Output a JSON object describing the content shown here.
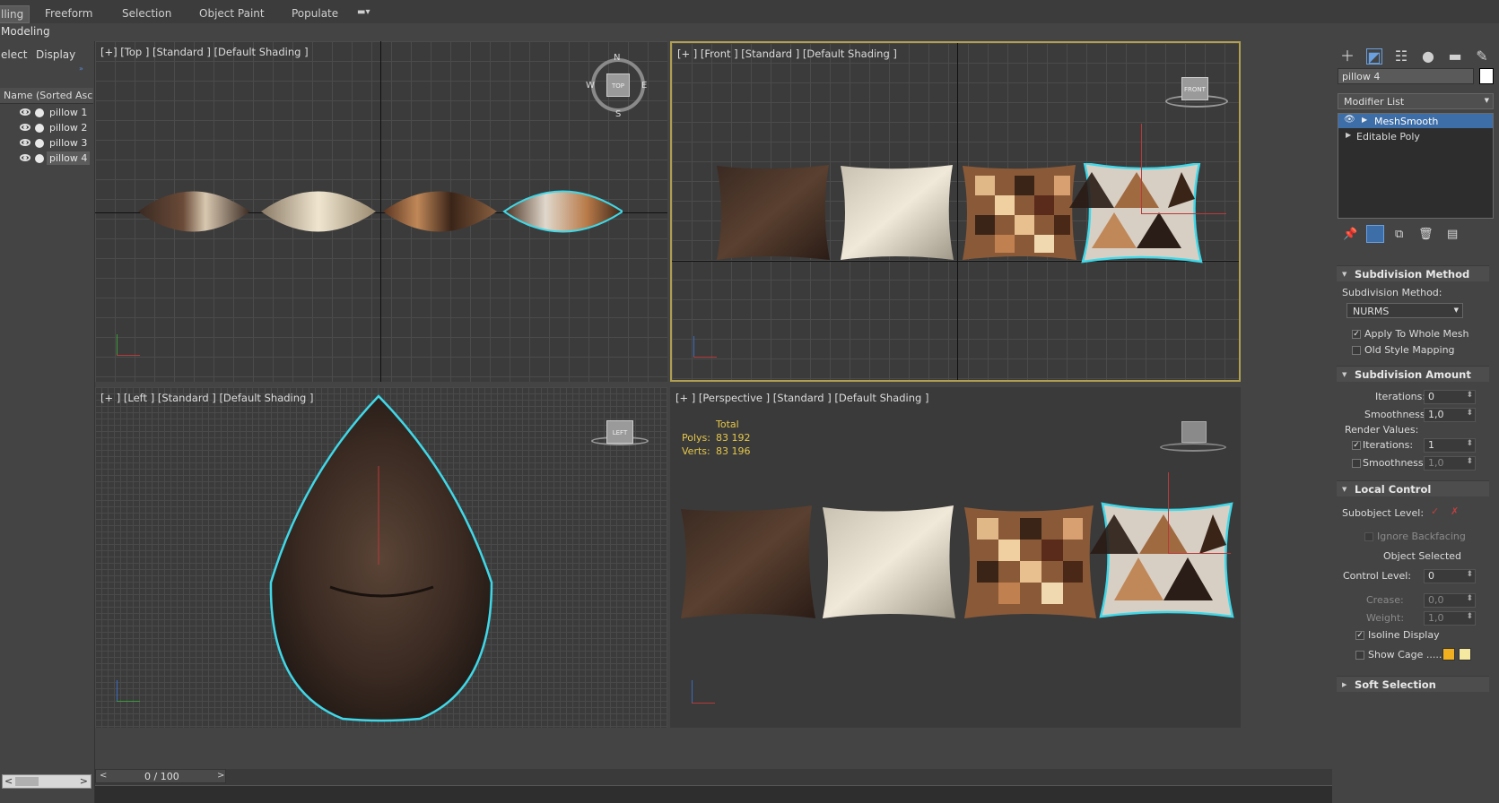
{
  "ribbon": {
    "tabs": [
      "lling",
      "Freeform",
      "Selection",
      "Object Paint",
      "Populate"
    ],
    "sub_label": "Modeling"
  },
  "explorer": {
    "menu": [
      "elect",
      "Display"
    ],
    "column_header": "Name (Sorted Ascen",
    "items": [
      {
        "label": "pillow 1",
        "selected": false
      },
      {
        "label": "pillow 2",
        "selected": false
      },
      {
        "label": "pillow 3",
        "selected": false
      },
      {
        "label": "pillow 4",
        "selected": true
      }
    ]
  },
  "viewports": {
    "top": {
      "label": "[+] [Top ] [Standard ] [Default Shading ]",
      "cube": "TOP",
      "compass": {
        "n": "N",
        "s": "S",
        "e": "E",
        "w": "W"
      }
    },
    "front": {
      "label": "[+ ] [Front ] [Standard ] [Default Shading ]",
      "cube": "FRONT"
    },
    "left": {
      "label": "[+ ] [Left ] [Standard ] [Default Shading ]",
      "cube": "LEFT"
    },
    "perspective": {
      "label": "[+ ] [Perspective ] [Standard ] [Default Shading ]",
      "stats": {
        "header": "Total",
        "polys_label": "Polys:",
        "polys": "83 192",
        "verts_label": "Verts:",
        "verts": "83 196"
      }
    }
  },
  "command_panel": {
    "object_name": "pillow 4",
    "modifier_list": "Modifier List",
    "stack": [
      "MeshSmooth",
      "Editable Poly"
    ],
    "subdivision_method": {
      "title": "Subdivision Method",
      "label": "Subdivision Method:",
      "value": "NURMS",
      "apply_whole_mesh": "Apply To Whole Mesh",
      "old_style_mapping": "Old Style Mapping"
    },
    "subdivision_amount": {
      "title": "Subdivision Amount",
      "iterations_label": "Iterations:",
      "iterations": "0",
      "smoothness_label": "Smoothness:",
      "smoothness": "1,0",
      "render_values": "Render Values:",
      "render_iterations_label": "Iterations:",
      "render_iterations": "1",
      "render_smoothness_label": "Smoothness:",
      "render_smoothness": "1,0"
    },
    "local_control": {
      "title": "Local Control",
      "subobject_level": "Subobject Level:",
      "ignore_backfacing": "Ignore Backfacing",
      "object_selected": "Object Selected",
      "control_level_label": "Control Level:",
      "control_level": "0",
      "crease_label": "Crease:",
      "crease": "0,0",
      "weight_label": "Weight:",
      "weight": "1,0",
      "isoline_display": "Isoline Display",
      "show_cage": "Show Cage ......"
    },
    "soft_selection": {
      "title": "Soft Selection"
    }
  },
  "timeline": {
    "frame": "0 / 100"
  },
  "colors": {
    "selection": "#3fd8e8",
    "stats": "#e6c84a",
    "cage1": "#f0b020",
    "cage2": "#f5e8a0"
  }
}
